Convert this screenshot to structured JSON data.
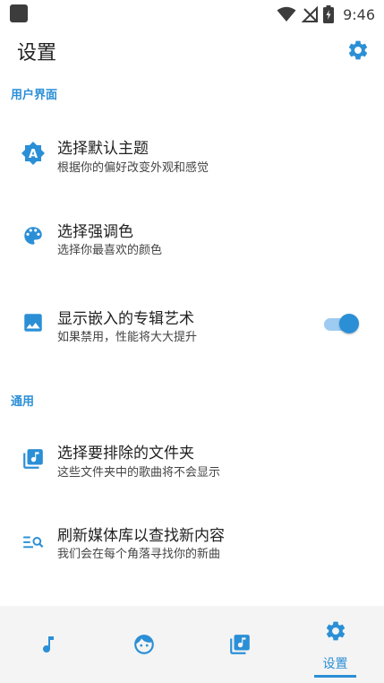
{
  "status_bar": {
    "time": "9:46"
  },
  "app_bar": {
    "title": "设置",
    "icon": "gear-icon"
  },
  "sections": [
    {
      "header": "用户界面",
      "items": [
        {
          "title": "选择默认主题",
          "subtitle": "根据你的偏好改变外观和感觉",
          "icon": "theme-icon"
        },
        {
          "title": "选择强调色",
          "subtitle": "选择你最喜欢的颜色",
          "icon": "palette-icon"
        },
        {
          "title": "显示嵌入的专辑艺术",
          "subtitle": "如果禁用，性能将大大提升",
          "icon": "image-icon",
          "toggle_on": true
        }
      ]
    },
    {
      "header": "通用",
      "items": [
        {
          "title": "选择要排除的文件夹",
          "subtitle": "这些文件夹中的歌曲将不会显示",
          "icon": "music-library-icon"
        },
        {
          "title": "刷新媒体库以查找新内容",
          "subtitle": "我们会在每个角落寻找你的新曲",
          "icon": "search-list-icon"
        }
      ]
    }
  ],
  "bottom_nav": {
    "items": [
      {
        "icon": "music-note-icon"
      },
      {
        "icon": "face-icon"
      },
      {
        "icon": "music-library-icon"
      },
      {
        "icon": "gear-icon",
        "label": "设置",
        "selected": true
      }
    ]
  },
  "colors": {
    "accent": "#2b8fd6",
    "toggle_track": "#9dcbf1",
    "text": "#212121",
    "nav_bg": "#f4f4f4"
  }
}
